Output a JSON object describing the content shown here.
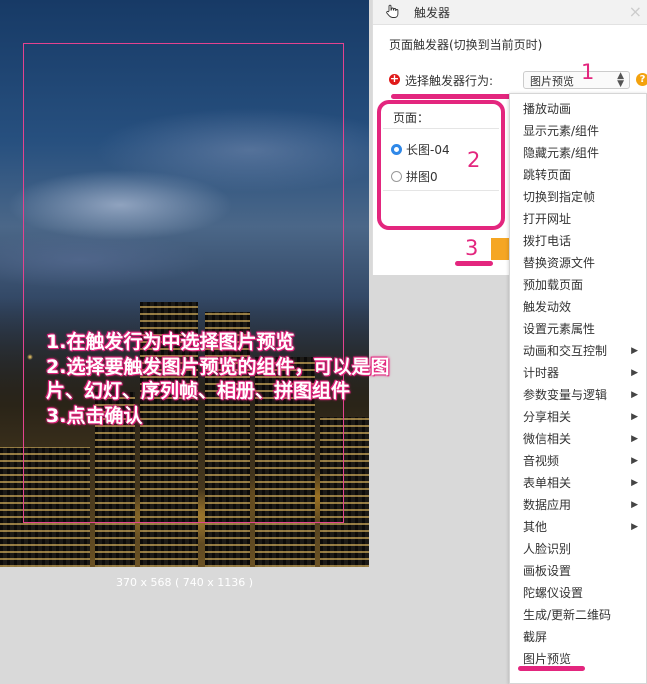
{
  "canvas": {
    "size_label": "370 x 568 ( 740 x 1136 )"
  },
  "instructions": [
    "1.在触发行为中选择图片预览",
    "2.选择要触发图片预览的组件，可以是图",
    "片、幻灯、序列帧、相册、拼图组件",
    "3.点击确认"
  ],
  "panel": {
    "title": "触发器",
    "close_icon": "×",
    "subtitle": "页面触发器(切换到当前页时)",
    "trigger_label": "选择触发器行为:",
    "trigger_value": "图片预览",
    "select_caret": "▲\n▼",
    "help_icon": "?",
    "plus_icon": "+",
    "page_label": "页面：",
    "options": [
      "长图-04",
      "拼图0"
    ],
    "selected_option": "长图-04"
  },
  "markers": {
    "one": "1",
    "two": "2",
    "three": "3"
  },
  "menu": {
    "items": [
      {
        "label": "播放动画",
        "submenu": false
      },
      {
        "label": "显示元素/组件",
        "submenu": false
      },
      {
        "label": "隐藏元素/组件",
        "submenu": false
      },
      {
        "label": "跳转页面",
        "submenu": false
      },
      {
        "label": "切换到指定帧",
        "submenu": false
      },
      {
        "label": "打开网址",
        "submenu": false
      },
      {
        "label": "拨打电话",
        "submenu": false
      },
      {
        "label": "替换资源文件",
        "submenu": false
      },
      {
        "label": "预加载页面",
        "submenu": false
      },
      {
        "label": "触发动效",
        "submenu": false
      },
      {
        "label": "设置元素属性",
        "submenu": false
      },
      {
        "label": "动画和交互控制",
        "submenu": true
      },
      {
        "label": "计时器",
        "submenu": true
      },
      {
        "label": "参数变量与逻辑",
        "submenu": true
      },
      {
        "label": "分享相关",
        "submenu": true
      },
      {
        "label": "微信相关",
        "submenu": true
      },
      {
        "label": "音视频",
        "submenu": true
      },
      {
        "label": "表单相关",
        "submenu": true
      },
      {
        "label": "数据应用",
        "submenu": true
      },
      {
        "label": "其他",
        "submenu": true
      },
      {
        "label": "人脸识别",
        "submenu": false
      },
      {
        "label": "画板设置",
        "submenu": false
      },
      {
        "label": "陀螺仪设置",
        "submenu": false
      },
      {
        "label": "生成/更新二维码",
        "submenu": false
      },
      {
        "label": "截屏",
        "submenu": false
      },
      {
        "label": "图片预览",
        "submenu": false
      }
    ],
    "arrow_glyph": "▶"
  },
  "colors": {
    "annotation": "#e3267e",
    "radio_selected": "#2f88e8",
    "confirm_button": "#f5a623"
  }
}
